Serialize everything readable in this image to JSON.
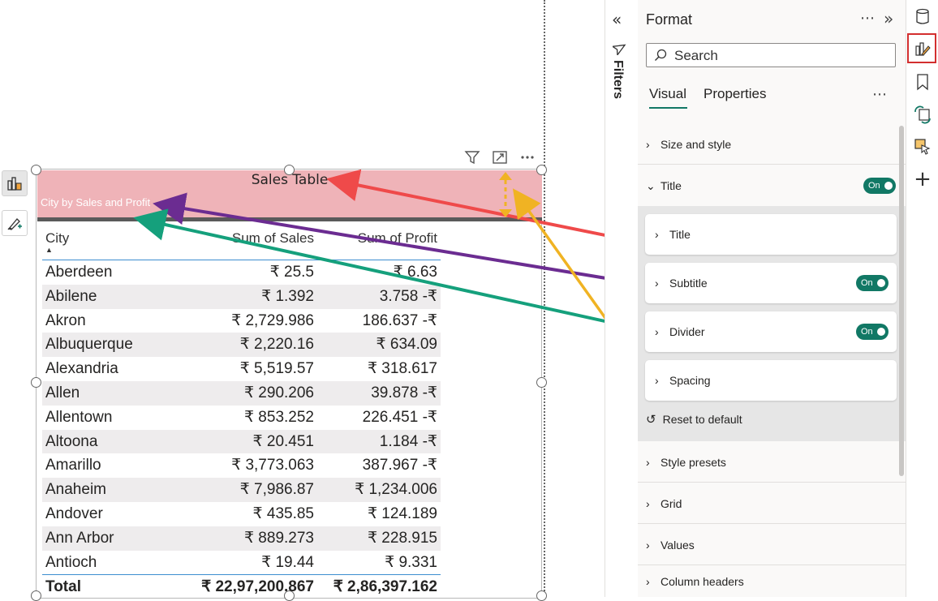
{
  "format_pane": {
    "title": "Format",
    "search_placeholder": "Search",
    "tabs": [
      {
        "label": "Visual",
        "active": true
      },
      {
        "label": "Properties",
        "active": false
      }
    ],
    "sections": {
      "size_and_style": "Size and style",
      "title": "Title",
      "title_toggle": "On",
      "sub": {
        "title": "Title",
        "subtitle": "Subtitle",
        "subtitle_toggle": "On",
        "divider": "Divider",
        "divider_toggle": "On",
        "spacing": "Spacing"
      },
      "reset": "Reset to default",
      "style_presets": "Style presets",
      "grid": "Grid",
      "values": "Values",
      "column_headers": "Column headers"
    }
  },
  "filters_pane": {
    "label": "Filters"
  },
  "visual": {
    "title": "Sales Table",
    "subtitle": "City by Sales and Profit",
    "table": {
      "columns": [
        "City",
        "Sum of Sales",
        "Sum of Profit"
      ],
      "rows": [
        [
          "Aberdeen",
          "₹ 25.5",
          "₹ 6.63"
        ],
        [
          "Abilene",
          "₹ 1.392",
          "3.758 -₹"
        ],
        [
          "Akron",
          "₹ 2,729.986",
          "186.637 -₹"
        ],
        [
          "Albuquerque",
          "₹ 2,220.16",
          "₹ 634.09"
        ],
        [
          "Alexandria",
          "₹ 5,519.57",
          "₹ 318.617"
        ],
        [
          "Allen",
          "₹ 290.206",
          "39.878 -₹"
        ],
        [
          "Allentown",
          "₹ 853.252",
          "226.451 -₹"
        ],
        [
          "Altoona",
          "₹ 20.451",
          "1.184 -₹"
        ],
        [
          "Amarillo",
          "₹ 3,773.063",
          "387.967 -₹"
        ],
        [
          "Anaheim",
          "₹ 7,986.87",
          "₹ 1,234.006"
        ],
        [
          "Andover",
          "₹ 435.85",
          "₹ 124.189"
        ],
        [
          "Ann Arbor",
          "₹ 889.273",
          "₹ 228.915"
        ],
        [
          "Antioch",
          "₹ 19.44",
          "₹ 9.331"
        ]
      ],
      "total": [
        "Total",
        "₹ 22,97,200.867",
        "₹ 2,86,397.162"
      ]
    }
  },
  "colors": {
    "title_band": "#efb3b8",
    "accent_teal": "#117865",
    "arrow_red": "#ef4a4a",
    "arrow_purple": "#6b2c91",
    "arrow_green": "#15a07c",
    "arrow_amber": "#f0b323",
    "highlight_red": "#d32f2f"
  },
  "icons": {
    "left_tools": [
      "build-visual-icon",
      "format-visual-icon"
    ],
    "visual_header": [
      "filter-icon",
      "focus-mode-icon",
      "more-options-icon"
    ],
    "rail": [
      "data-icon",
      "format-icon",
      "bookmark-icon",
      "sync-icon",
      "selection-icon",
      "add-icon"
    ]
  }
}
